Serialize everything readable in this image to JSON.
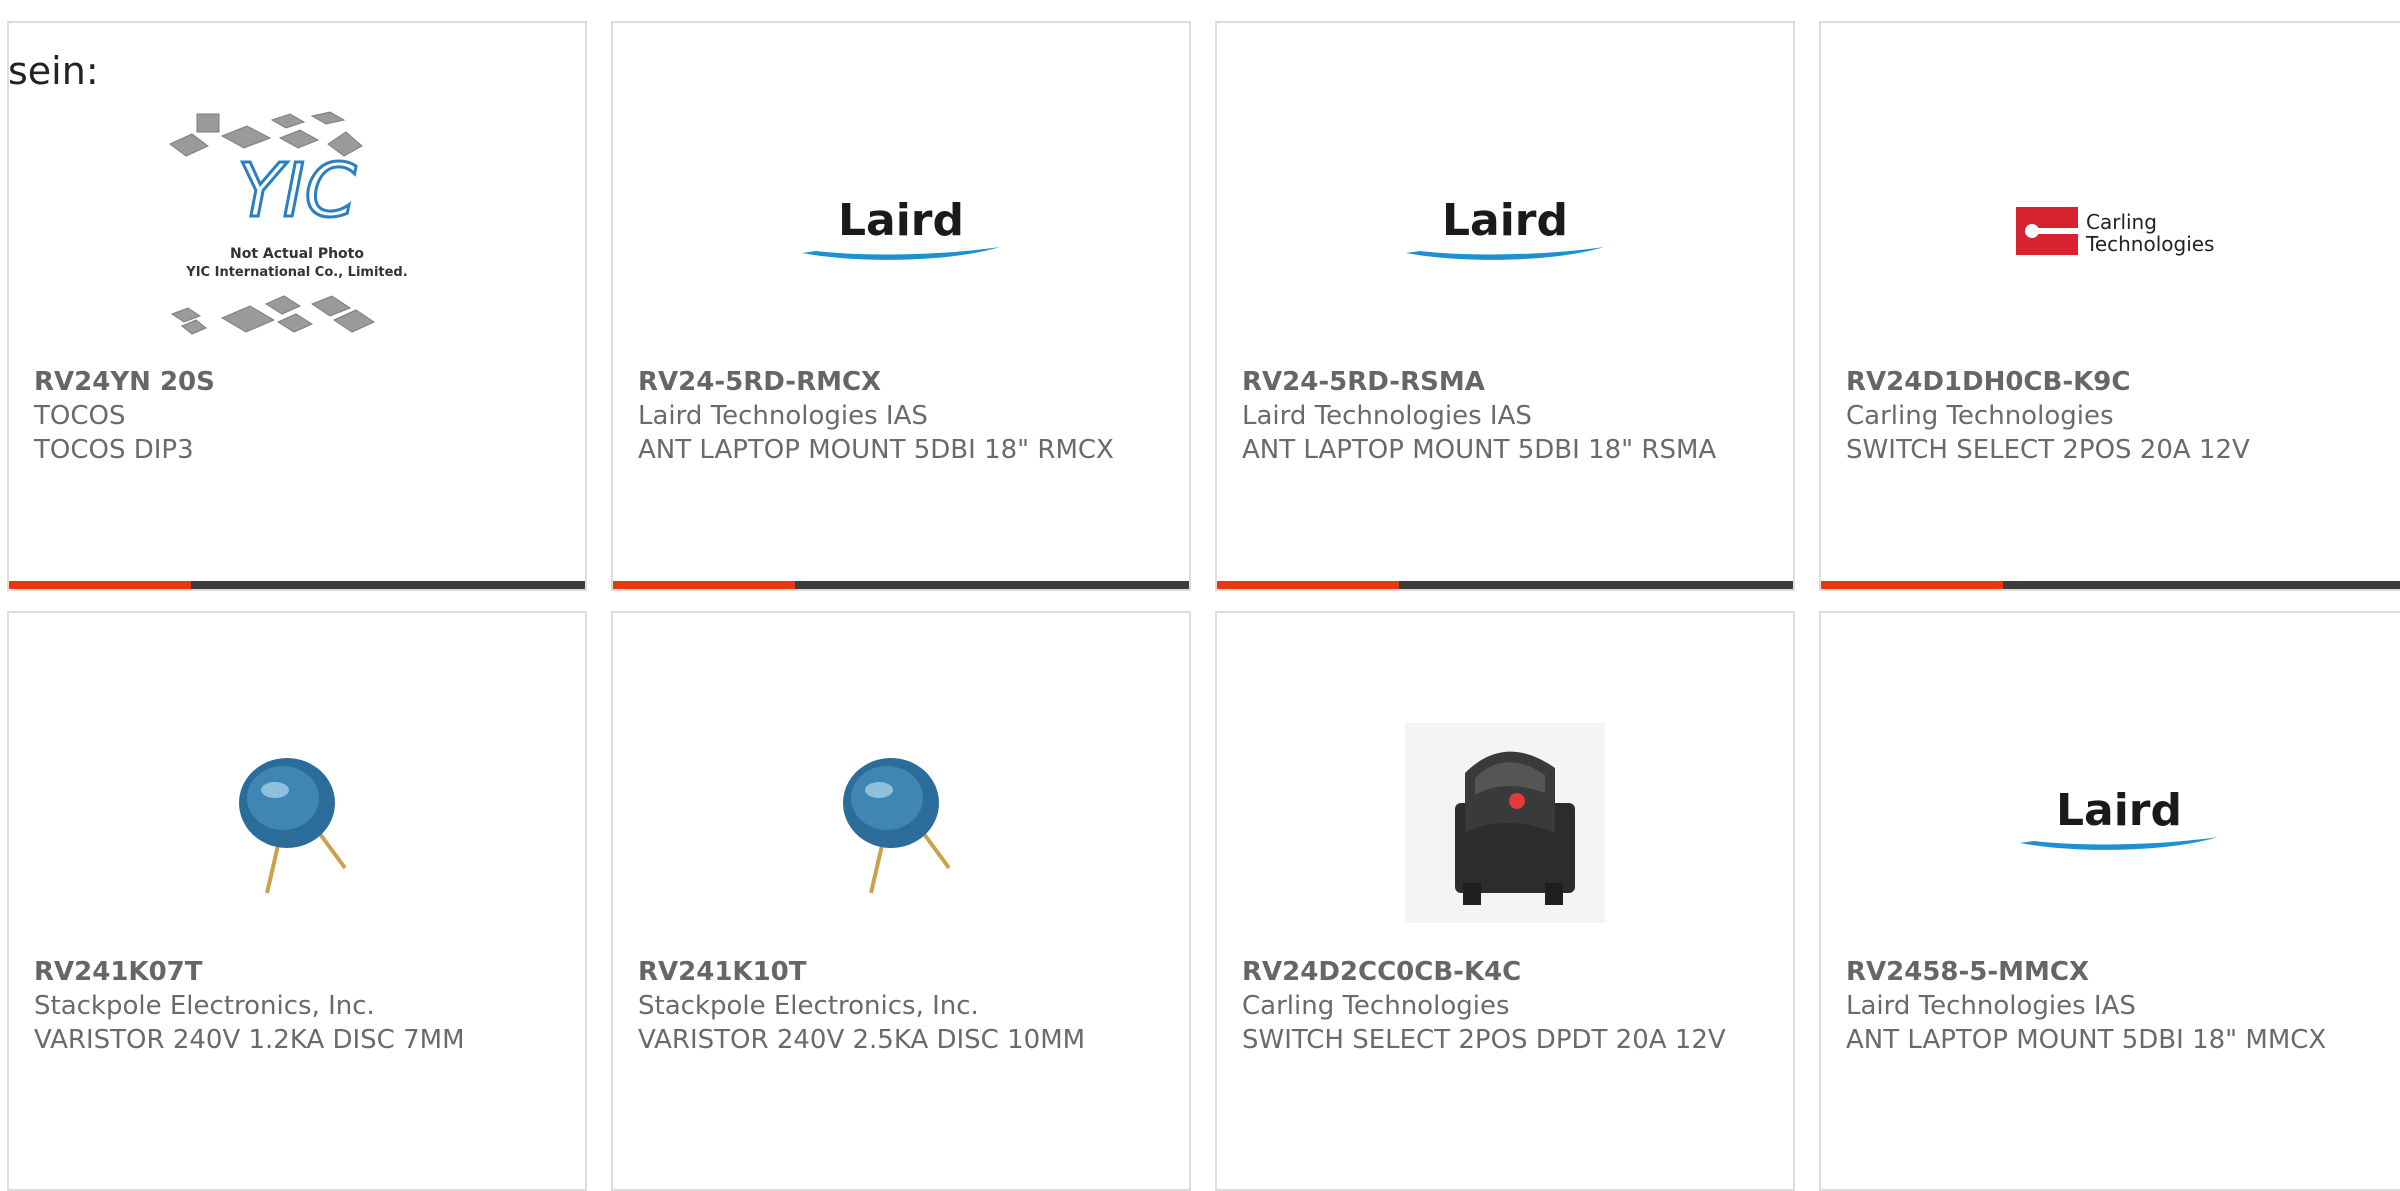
{
  "intro_text": "sein:",
  "products": [
    {
      "part": "RV24YN 20S",
      "maker": "TOCOS",
      "desc": "TOCOS DIP3",
      "image": "yic-placeholder-photo",
      "image_caption_1": "Not Actual Photo",
      "image_caption_2": "YIC International Co., Limited.",
      "logo_text": "YIC"
    },
    {
      "part": "RV24-5RD-RMCX",
      "maker": "Laird Technologies IAS",
      "desc": "ANT LAPTOP MOUNT 5DBI 18\" RMCX",
      "image": "laird-logo",
      "logo_text": "Laird"
    },
    {
      "part": "RV24-5RD-RSMA",
      "maker": "Laird Technologies IAS",
      "desc": "ANT LAPTOP MOUNT 5DBI 18\" RSMA",
      "image": "laird-logo",
      "logo_text": "Laird"
    },
    {
      "part": "RV24D1DH0CB-K9C",
      "maker": "Carling Technologies",
      "desc": "SWITCH SELECT 2POS 20A 12V",
      "image": "carling-logo",
      "logo_text_1": "Carling",
      "logo_text_2": "Technologies"
    },
    {
      "part": "RV241K07T",
      "maker": "Stackpole Electronics, Inc.",
      "desc": "VARISTOR 240V 1.2KA DISC 7MM",
      "image": "varistor-photo"
    },
    {
      "part": "RV241K10T",
      "maker": "Stackpole Electronics, Inc.",
      "desc": "VARISTOR 240V 2.5KA DISC 10MM",
      "image": "varistor-photo"
    },
    {
      "part": "RV24D2CC0CB-K4C",
      "maker": "Carling Technologies",
      "desc": "SWITCH SELECT 2POS DPDT 20A 12V",
      "image": "rocker-switch-photo"
    },
    {
      "part": "RV2458-5-MMCX",
      "maker": "Laird Technologies IAS",
      "desc": "ANT LAPTOP MOUNT 5DBI 18\" MMCX",
      "image": "laird-logo",
      "logo_text": "Laird"
    }
  ],
  "colors": {
    "accent": "#e8380d",
    "bar": "#3c3c3c",
    "border": "#dcdcdc",
    "laird_blue": "#1e8fd0",
    "carling_red": "#d7232f",
    "varistor_blue": "#2b6c9b"
  }
}
